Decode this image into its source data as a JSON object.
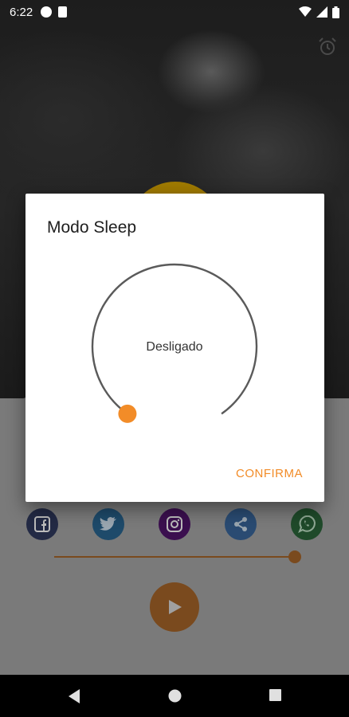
{
  "statusbar": {
    "time": "6:22"
  },
  "dialog": {
    "title": "Modo Sleep",
    "dial_value_label": "Desligado",
    "dial_level": 0,
    "confirm_label": "CONFIRMA"
  },
  "social": [
    {
      "name": "facebook",
      "glyph": "f"
    },
    {
      "name": "twitter",
      "glyph": ""
    },
    {
      "name": "instagram",
      "glyph": ""
    },
    {
      "name": "share",
      "glyph": ""
    },
    {
      "name": "whatsapp",
      "glyph": ""
    }
  ],
  "player": {
    "volume_level": 1.0
  },
  "colors": {
    "accent": "#f28c28",
    "dial_track": "#5a5a5a",
    "dialog_bg": "#ffffff"
  },
  "icons": {
    "alarm": "alarm-clock-icon",
    "play": "play-icon",
    "nav_back": "back-triangle-icon",
    "nav_home": "home-circle-icon",
    "nav_recents": "recents-square-icon"
  }
}
